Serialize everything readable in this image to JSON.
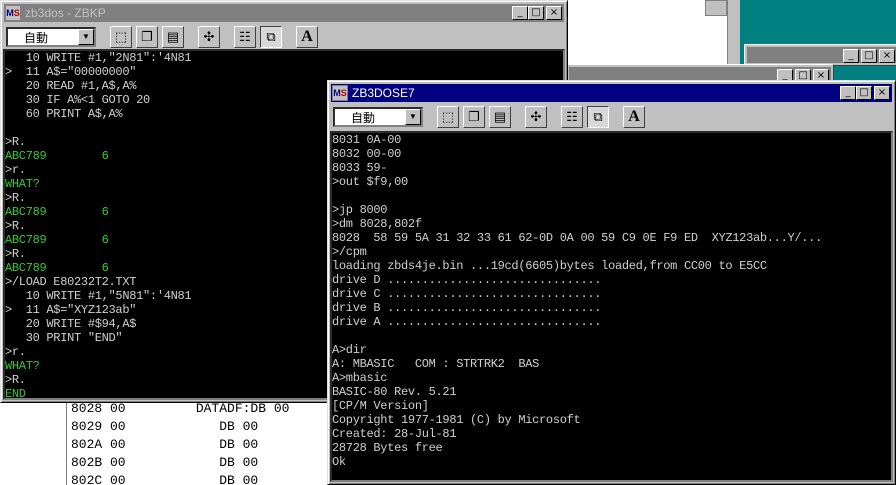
{
  "zbkp_window": {
    "title": "zb3dos - ZBKP",
    "combo_value": "自動",
    "lines": [
      {
        "text": "   10 WRITE #1,\"2N81\":'4N81",
        "color": "w"
      },
      {
        "text": ">  11 A$=\"00000000\"",
        "color": "w"
      },
      {
        "text": "   20 READ #1,A$,A%",
        "color": "w"
      },
      {
        "text": "   30 IF A%<1 GOTO 20",
        "color": "w"
      },
      {
        "text": "   60 PRINT A$,A%",
        "color": "w"
      },
      {
        "text": "",
        "color": "w"
      },
      {
        "text": ">R.",
        "color": "w"
      },
      {
        "text": "ABC789        6",
        "color": "g"
      },
      {
        "text": ">r.",
        "color": "w"
      },
      {
        "text": "WHAT?",
        "color": "g"
      },
      {
        "text": ">R.",
        "color": "w"
      },
      {
        "text": "ABC789        6",
        "color": "g"
      },
      {
        "text": ">R.",
        "color": "w"
      },
      {
        "text": "ABC789        6",
        "color": "g"
      },
      {
        "text": ">R.",
        "color": "w"
      },
      {
        "text": "ABC789        6",
        "color": "g"
      },
      {
        "text": ">/LOAD E80232T2.TXT",
        "color": "w"
      },
      {
        "text": "   10 WRITE #1,\"5N81\":'4N81",
        "color": "w"
      },
      {
        "text": ">  11 A$=\"XYZ123ab\"",
        "color": "w"
      },
      {
        "text": "   20 WRITE #$94,A$",
        "color": "w"
      },
      {
        "text": "   30 PRINT \"END\"",
        "color": "w"
      },
      {
        "text": ">r.",
        "color": "w"
      },
      {
        "text": "WHAT?",
        "color": "g"
      },
      {
        "text": ">R.",
        "color": "w"
      },
      {
        "text": "END",
        "color": "g"
      },
      {
        "text": ">",
        "color": "g"
      }
    ]
  },
  "zb3dose7_window": {
    "title": "ZB3DOSE7",
    "combo_value": "自動",
    "lines": [
      "8031 0A-00",
      "8032 00-00",
      "8033 59-",
      ">out $f9,00",
      "",
      ">jp 8000",
      ">dm 8028,802f",
      "8028  58 59 5A 31 32 33 61 62-0D 0A 00 59 C9 0E F9 ED  XYZ123ab...Y/...",
      ">/cpm",
      "loading zbds4je.bin ...19cd(6605)bytes loaded,from CC00 to E5CC",
      "drive D ...............................",
      "drive C ...............................",
      "drive B ...............................",
      "drive A ...............................",
      "",
      "A>dir",
      "A: MBASIC   COM : STRTRK2  BAS",
      "A>mbasic",
      "BASIC-80 Rev. 5.21",
      "[CP/M Version]",
      "Copyright 1977-1981 (C) by Microsoft",
      "Created: 28-Jul-81",
      "28728 Bytes free",
      "Ok"
    ]
  },
  "asm_listing": {
    "lines": [
      "8028 00         DATADF:DB 00",
      "8029 00            DB 00",
      "802A 00            DB 00",
      "802B 00            DB 00",
      "802C 00            DB 00"
    ]
  },
  "toolbar_icons": [
    "select-icon",
    "copy-icon",
    "paste-icon",
    "fullscreen-icon",
    "properties-icon",
    "background-icon",
    "font-icon"
  ],
  "font_button_label": "A",
  "colors": {
    "active_title": "#000080",
    "inactive_title": "#808080",
    "terminal_bg": "#000000",
    "green_text": "#33cc33",
    "white_text": "#d0d0d0"
  }
}
